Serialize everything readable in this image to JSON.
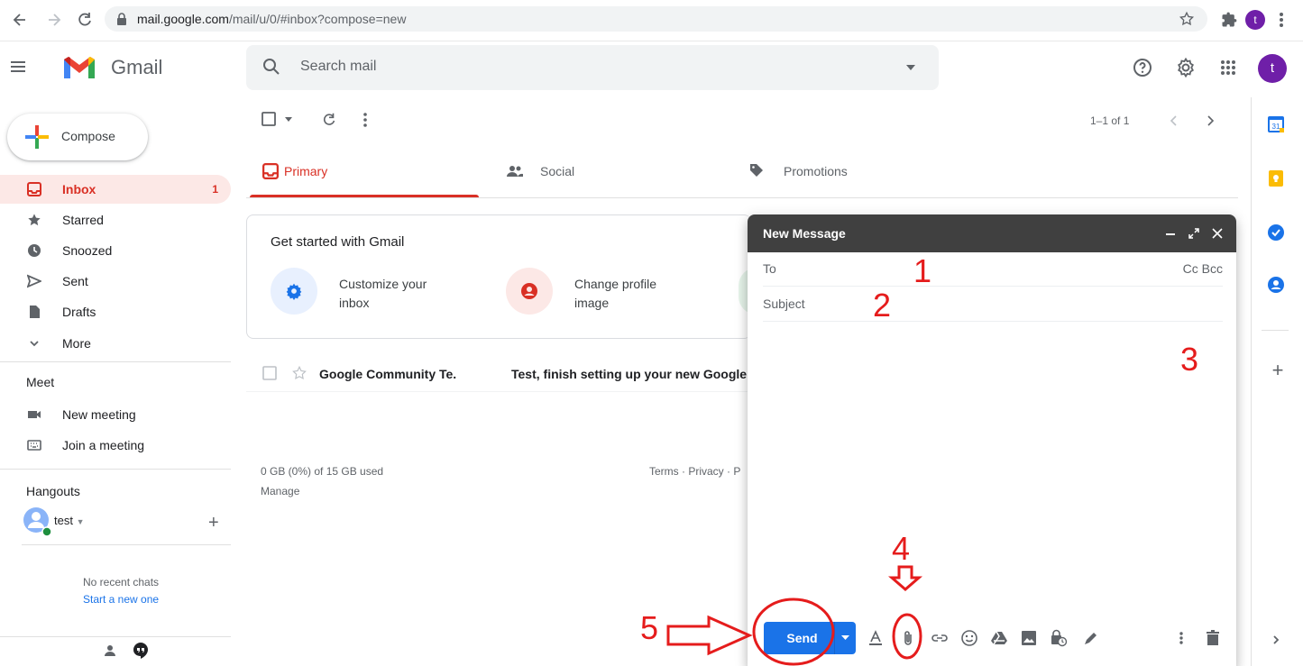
{
  "browser": {
    "url_host": "mail.google.com",
    "url_path": "/mail/u/0/#inbox?compose=new",
    "profile_initial": "t"
  },
  "header": {
    "app_name": "Gmail",
    "search_placeholder": "Search mail",
    "avatar_initial": "t"
  },
  "sidebar": {
    "compose_label": "Compose",
    "items": [
      {
        "label": "Inbox",
        "count": "1"
      },
      {
        "label": "Starred"
      },
      {
        "label": "Snoozed"
      },
      {
        "label": "Sent"
      },
      {
        "label": "Drafts"
      },
      {
        "label": "More"
      }
    ],
    "meet": {
      "title": "Meet",
      "new_meeting": "New meeting",
      "join_meeting": "Join a meeting"
    },
    "hangouts": {
      "title": "Hangouts",
      "user": "test",
      "no_chats": "No recent chats",
      "start_new": "Start a new one"
    }
  },
  "toolbar": {
    "pagination": "1–1 of 1"
  },
  "tabs": [
    {
      "label": "Primary"
    },
    {
      "label": "Social"
    },
    {
      "label": "Promotions"
    }
  ],
  "getstarted": {
    "title": "Get started with Gmail",
    "card1": "Customize your inbox",
    "card1_l1": "Customize your",
    "card1_l2": "inbox",
    "card2_l1": "Change profile",
    "card2_l2": "image"
  },
  "email": {
    "sender": "Google Community Te.",
    "subject": "Test, finish setting up your new Google"
  },
  "footer": {
    "storage": "0 GB (0%) of 15 GB used",
    "manage": "Manage",
    "links": "Terms · Privacy · P"
  },
  "compose_window": {
    "title": "New Message",
    "to_label": "To",
    "cc_bcc": "Cc Bcc",
    "subject_placeholder": "Subject",
    "send_label": "Send"
  },
  "annotations": {
    "n1": "1",
    "n2": "2",
    "n3": "3",
    "n4": "4",
    "n5": "5",
    "color": "#e51c1c"
  },
  "colors": {
    "accent_red": "#d93025",
    "send_blue": "#1a73e8",
    "compose_header": "#404040"
  }
}
